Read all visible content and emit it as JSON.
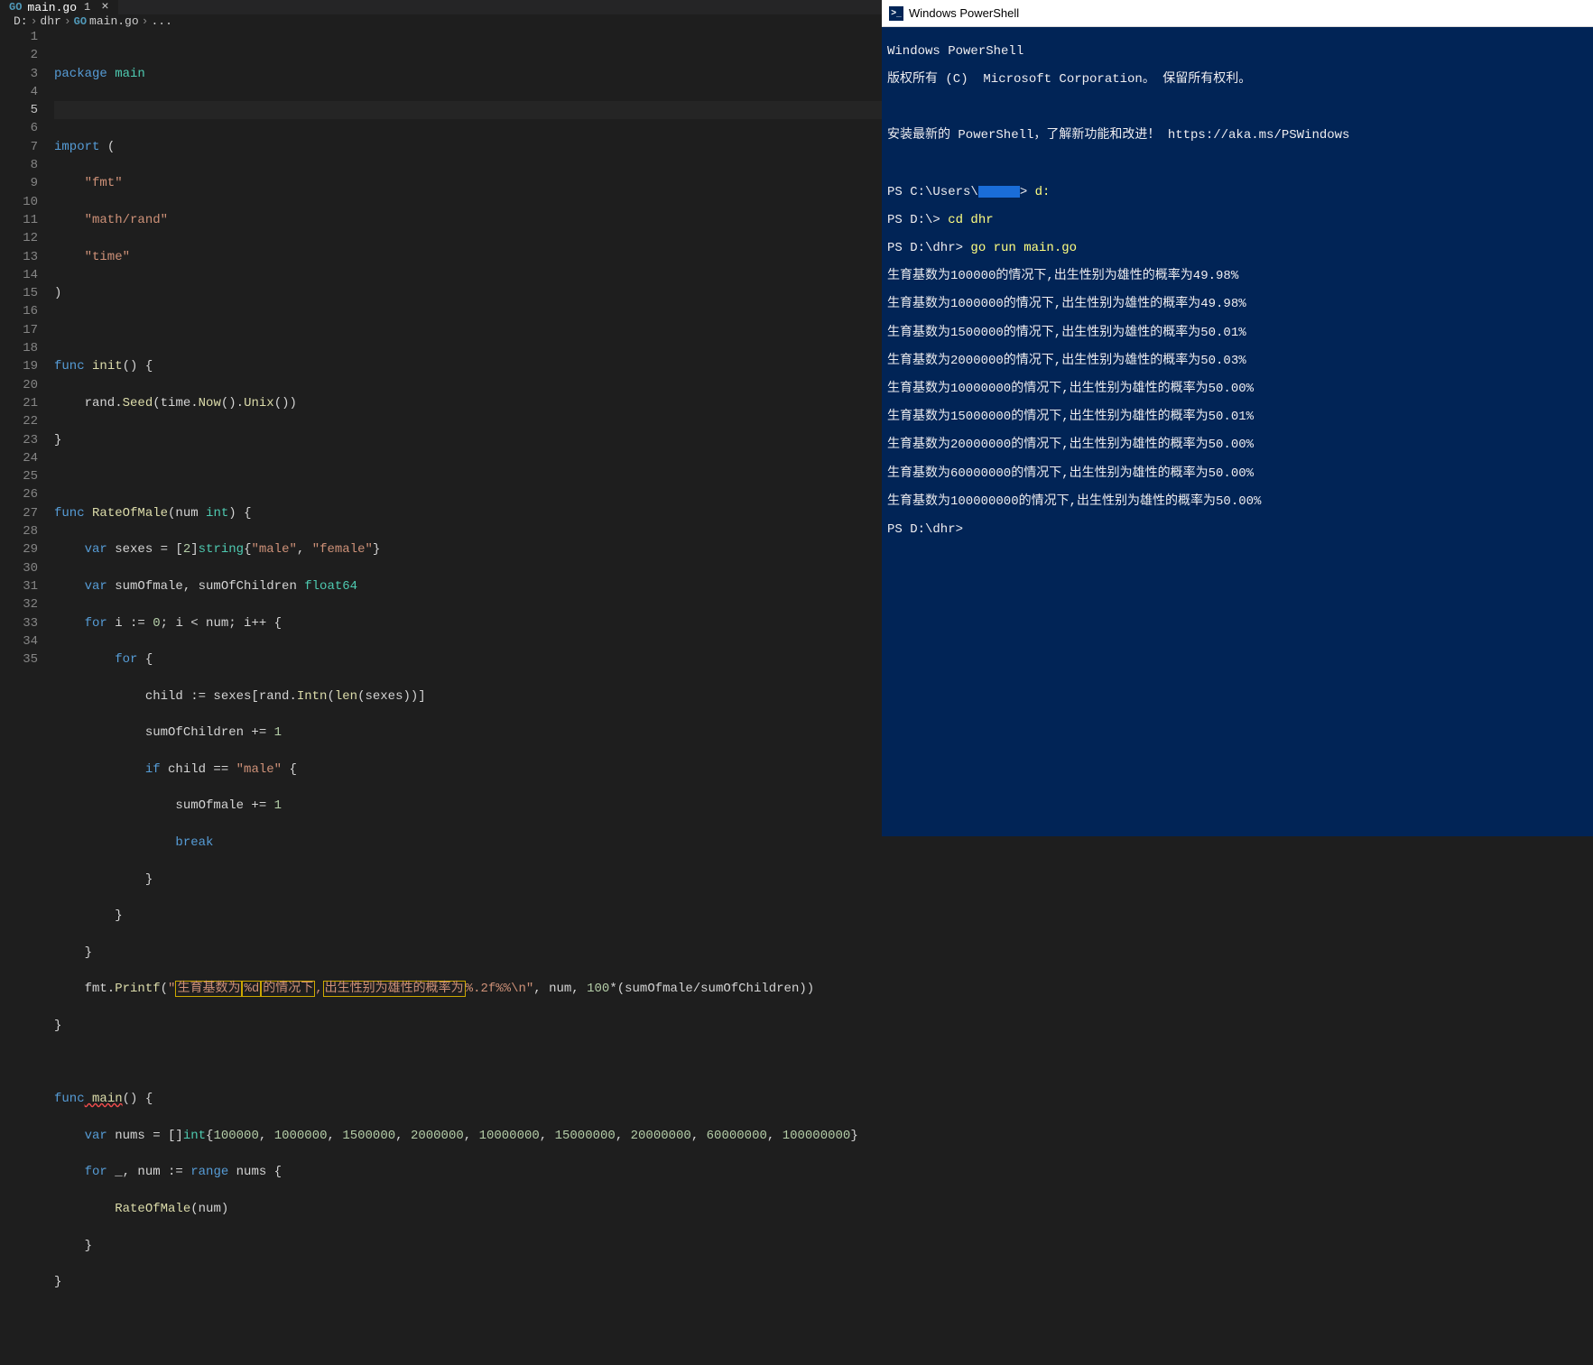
{
  "tab": {
    "icon": "go-icon",
    "filename": "main.go",
    "dirty_marker": "1"
  },
  "breadcrumbs": {
    "root": "D:",
    "folder": "dhr",
    "file": "main.go",
    "more": "..."
  },
  "code": {
    "l1_a": "package",
    "l1_b": " main",
    "l3_a": "import",
    "l3_b": " (",
    "l4": "    \"fmt\"",
    "l5": "    \"math/rand\"",
    "l6": "    \"time\"",
    "l7": ")",
    "l9_a": "func",
    "l9_b": " init",
    "l9_c": "() {",
    "l10_a": "    rand.",
    "l10_b": "Seed",
    "l10_c": "(time.",
    "l10_d": "Now",
    "l10_e": "().",
    "l10_f": "Unix",
    "l10_g": "())",
    "l11": "}",
    "l13_a": "func",
    "l13_b": " RateOfMale",
    "l13_c": "(num ",
    "l13_d": "int",
    "l13_e": ") {",
    "l14_a": "    var",
    "l14_b": " sexes = [",
    "l14_c": "2",
    "l14_d": "]",
    "l14_e": "string",
    "l14_f": "{",
    "l14_g": "\"male\"",
    "l14_h": ", ",
    "l14_i": "\"female\"",
    "l14_j": "}",
    "l15_a": "    var",
    "l15_b": " sumOfmale, sumOfChildren ",
    "l15_c": "float64",
    "l16_a": "    for",
    "l16_b": " i := ",
    "l16_c": "0",
    "l16_d": "; i < num; i++ {",
    "l17_a": "        for",
    "l17_b": " {",
    "l18_a": "            child := sexes[rand.",
    "l18_b": "Intn",
    "l18_c": "(",
    "l18_d": "len",
    "l18_e": "(sexes))]",
    "l19_a": "            sumOfChildren += ",
    "l19_b": "1",
    "l20_a": "            if",
    "l20_b": " child == ",
    "l20_c": "\"male\"",
    "l20_d": " {",
    "l21_a": "                sumOfmale += ",
    "l21_b": "1",
    "l22_a": "                break",
    "l23": "            }",
    "l24": "        }",
    "l25": "    }",
    "l26_a": "    fmt.",
    "l26_b": "Printf",
    "l26_c": "(",
    "l26_d": "\"",
    "l26_e": "生育基数为",
    "l26_f": "%d",
    "l26_g": "的情况下",
    "l26_h": ",",
    "l26_i": "出生性别为雄性的概率为",
    "l26_j": "%.2f%%\\n\"",
    "l26_k": ", num, ",
    "l26_l": "100",
    "l26_m": "*(sumOfmale/sumOfChildren))",
    "l27": "}",
    "l29_a": "func",
    "l29_b": " main",
    "l29_c": "() {",
    "l30_a": "    var",
    "l30_b": " nums = []",
    "l30_c": "int",
    "l30_d": "{",
    "l30_e": "100000",
    "l30_f": ", ",
    "l30_g": "1000000",
    "l30_h": ", ",
    "l30_i": "1500000",
    "l30_j": ", ",
    "l30_k": "2000000",
    "l30_l": ", ",
    "l30_m": "10000000",
    "l30_n": ", ",
    "l30_o": "15000000",
    "l30_p": ", ",
    "l30_q": "20000000",
    "l30_r": ", ",
    "l30_s": "60000000",
    "l30_t": ", ",
    "l30_u": "100000000",
    "l30_v": "}",
    "l31_a": "    for",
    "l31_b": " _, num := ",
    "l31_c": "range",
    "l31_d": " nums {",
    "l32_a": "        RateOfMale",
    "l32_b": "(num)",
    "l33": "    }",
    "l34": "}"
  },
  "terminal": {
    "title": "Windows PowerShell",
    "lines": {
      "hdr1": "Windows PowerShell",
      "hdr2": "版权所有 (C)  Microsoft Corporation。 保留所有权利。",
      "install": "安装最新的 PowerShell，了解新功能和改进！ https://aka.ms/PSWindows",
      "p1a": "PS C:\\Users\\",
      "p1b": "> ",
      "p1c": "d:",
      "p2a": "PS D:\\> ",
      "p2b": "cd dhr",
      "p3a": "PS D:\\dhr> ",
      "p3b": "go run main.go",
      "o1": "生育基数为100000的情况下,出生性别为雄性的概率为49.98%",
      "o2": "生育基数为1000000的情况下,出生性别为雄性的概率为49.98%",
      "o3": "生育基数为1500000的情况下,出生性别为雄性的概率为50.01%",
      "o4": "生育基数为2000000的情况下,出生性别为雄性的概率为50.03%",
      "o5": "生育基数为10000000的情况下,出生性别为雄性的概率为50.00%",
      "o6": "生育基数为15000000的情况下,出生性别为雄性的概率为50.01%",
      "o7": "生育基数为20000000的情况下,出生性别为雄性的概率为50.00%",
      "o8": "生育基数为60000000的情况下,出生性别为雄性的概率为50.00%",
      "o9": "生育基数为100000000的情况下,出生性别为雄性的概率为50.00%",
      "p4": "PS D:\\dhr>"
    }
  }
}
